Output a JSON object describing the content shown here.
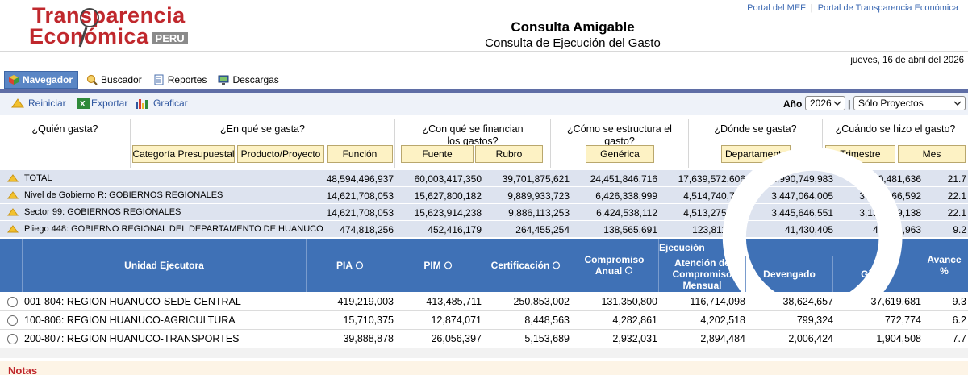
{
  "header": {
    "logo_line1": "Transparencia",
    "logo_line2": "Económica",
    "logo_badge": "PERU",
    "title": "Consulta Amigable",
    "subtitle": "Consulta de Ejecución del Gasto",
    "links": [
      "Portal del MEF",
      "Portal de Transparencia Económica"
    ],
    "date": "jueves, 16 de abril del 2026"
  },
  "tabs": [
    {
      "label": "Navegador",
      "icon": "cube-icon",
      "active": true
    },
    {
      "label": "Buscador",
      "icon": "magnifier-icon",
      "active": false
    },
    {
      "label": "Reportes",
      "icon": "document-icon",
      "active": false
    },
    {
      "label": "Descargas",
      "icon": "monitor-icon",
      "active": false
    }
  ],
  "toolbar": {
    "reiniciar": "Reiniciar",
    "exportar": "Exportar",
    "graficar": "Graficar",
    "year_label": "Año",
    "year_value": "2026",
    "bar_separator": "|",
    "filter_value": "Sólo Proyectos"
  },
  "questions": {
    "quien": "¿Quién gasta?",
    "que": "¿En qué se gasta?",
    "con_que": "¿Con qué se financian los gastos?",
    "como": "¿Cómo se estructura el gasto?",
    "donde": "¿Dónde se gasta?",
    "cuando": "¿Cuándo se hizo el gasto?"
  },
  "question_buttons": {
    "categoria": "Categoría Presupuestal",
    "producto": "Producto/Proyecto",
    "funcion": "Función",
    "fuente": "Fuente",
    "rubro": "Rubro",
    "generica": "Genérica",
    "departamento": "Departamento",
    "trimestre": "Trimestre",
    "mes": "Mes"
  },
  "summary_rows": [
    {
      "label": "TOTAL",
      "pia": "48,594,496,937",
      "pim": "60,003,417,350",
      "cert": "39,701,875,621",
      "comp": "24,451,846,716",
      "aten": "17,639,572,606",
      "dev": "12,990,749,983",
      "gir": "12,130,481,636",
      "av": "21.7"
    },
    {
      "label": "Nivel de Gobierno R: GOBIERNOS REGIONALES",
      "pia": "14,621,708,053",
      "pim": "15,627,800,182",
      "cert": "9,889,933,723",
      "comp": "6,426,338,999",
      "aten": "4,514,740,787",
      "dev": "3,447,064,005",
      "gir": "3,132,466,592",
      "av": "22.1"
    },
    {
      "label": "Sector 99: GOBIERNOS REGIONALES",
      "pia": "14,621,708,053",
      "pim": "15,623,914,238",
      "cert": "9,886,113,253",
      "comp": "6,424,538,112",
      "aten": "4,513,275,026",
      "dev": "3,445,646,551",
      "gir": "3,131,049,138",
      "av": "22.1"
    },
    {
      "label": "Pliego 448: GOBIERNO REGIONAL DEL DEPARTAMENTO DE HUANUCO",
      "pia": "474,818,256",
      "pim": "452,416,179",
      "cert": "264,455,254",
      "comp": "138,565,691",
      "aten": "123,811,101",
      "dev": "41,430,405",
      "gir": "40,296,963",
      "av": "9.2"
    }
  ],
  "table_header": {
    "unidad": "Unidad Ejecutora",
    "pia": "PIA",
    "pim": "PIM",
    "cert": "Certificación",
    "comp": "Compromiso Anual",
    "ejecucion": "Ejecución",
    "aten": "Atención de Compromiso Mensual",
    "dev": "Devengado",
    "gir": "Girado",
    "av": "Avance %"
  },
  "detail_rows": [
    {
      "ue": "001-804: REGION HUANUCO-SEDE CENTRAL",
      "pia": "419,219,003",
      "pim": "413,485,711",
      "cert": "250,853,002",
      "comp": "131,350,800",
      "aten": "116,714,098",
      "dev": "38,624,657",
      "gir": "37,619,681",
      "av": "9.3"
    },
    {
      "ue": "100-806: REGION HUANUCO-AGRICULTURA",
      "pia": "15,710,375",
      "pim": "12,874,071",
      "cert": "8,448,563",
      "comp": "4,282,861",
      "aten": "4,202,518",
      "dev": "799,324",
      "gir": "772,774",
      "av": "6.2"
    },
    {
      "ue": "200-807: REGION HUANUCO-TRANSPORTES",
      "pia": "39,888,878",
      "pim": "26,056,397",
      "cert": "5,153,689",
      "comp": "2,932,031",
      "aten": "2,894,484",
      "dev": "2,006,424",
      "gir": "1,904,508",
      "av": "7.7"
    }
  ],
  "notas": "Notas",
  "colors": {
    "brand_red": "#c0282d",
    "header_blue": "#3f71b6",
    "button_yellow": "#fdf2c4",
    "summary_bg": "#dde3ef"
  }
}
